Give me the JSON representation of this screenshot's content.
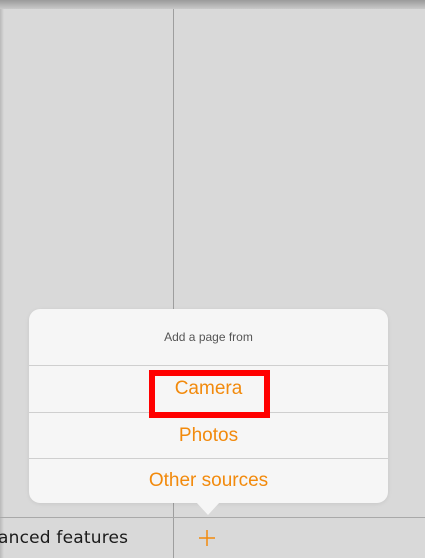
{
  "bottom_toolbar": {
    "features_label": "anced features",
    "add_icon": "plus-icon",
    "accent_color": "#f28a0c"
  },
  "popover": {
    "title": "Add a page from",
    "options": [
      {
        "label": "Camera",
        "highlighted": true
      },
      {
        "label": "Photos"
      },
      {
        "label": "Other sources"
      }
    ]
  },
  "highlight_color": "#ff0000"
}
